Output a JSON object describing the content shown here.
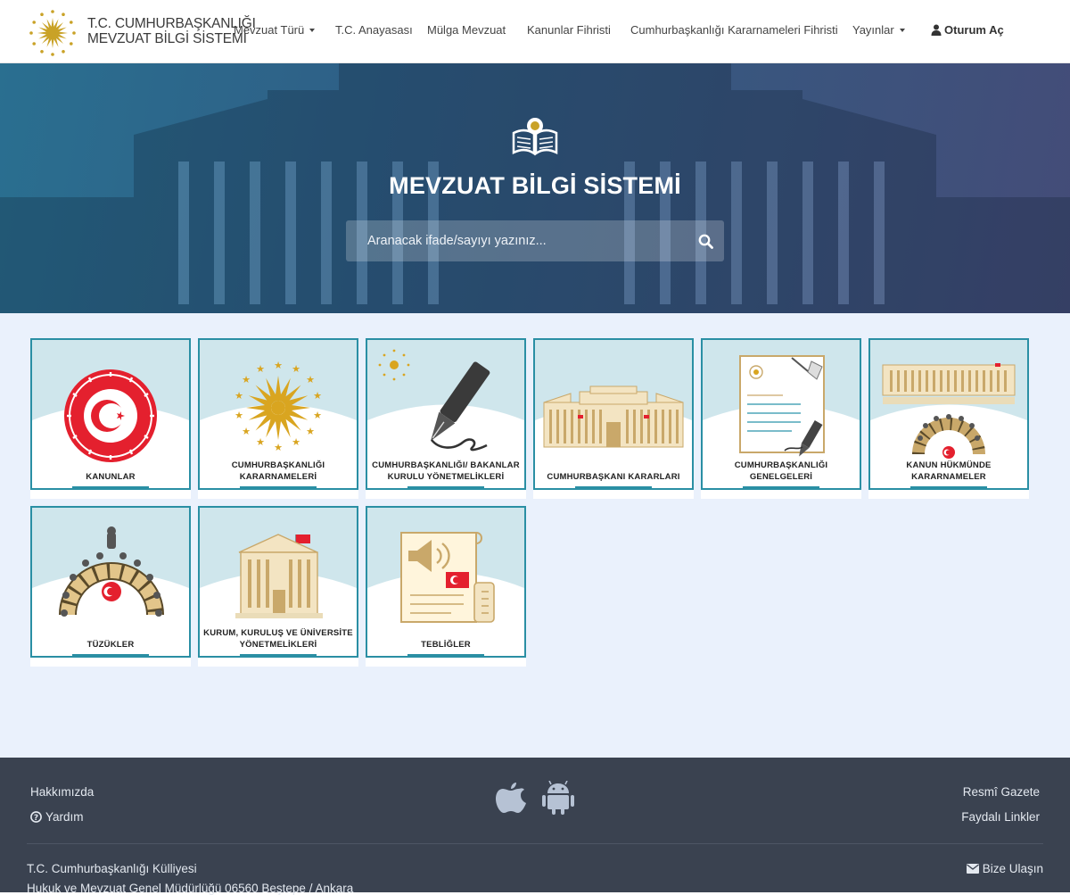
{
  "brand": {
    "line1": "T.C. CUMHURBAŞKANLIĞI",
    "line2": "MEVZUAT BİLGİ SİSTEMİ"
  },
  "nav": {
    "items": [
      {
        "label": "Mevzuat Türü",
        "dropdown": true
      },
      {
        "label": "T.C. Anayasası",
        "dropdown": false
      },
      {
        "label": "Mülga Mevzuat",
        "dropdown": false
      },
      {
        "label": "Kanunlar Fihristi",
        "dropdown": false
      },
      {
        "label": "Cumhurbaşkanlığı Kararnameleri Fihristi",
        "dropdown": false
      },
      {
        "label": "Yayınlar",
        "dropdown": true
      }
    ],
    "login_label": "Oturum Aç",
    "login_icon": "user-icon"
  },
  "hero": {
    "title": "MEVZUAT BİLGİ SİSTEMİ",
    "search_placeholder": "Aranacak ifade/sayıyı yazınız...",
    "search_icon": "search-icon"
  },
  "cards": [
    {
      "label": "KANUNLAR",
      "icon": "tbmm-seal-icon"
    },
    {
      "label": "CUMHURBAŞKANLIĞI KARARNAMELERİ",
      "icon": "presidential-emblem-icon"
    },
    {
      "label": "CUMHURBAŞKANLIĞI/ BAKANLAR KURULU YÖNETMELİKLERİ",
      "icon": "fountain-pen-icon"
    },
    {
      "label": "CUMHURBAŞKANI KARARLARI",
      "icon": "presidential-complex-icon"
    },
    {
      "label": "CUMHURBAŞKANLIĞI GENELGELERİ",
      "icon": "document-pen-icon"
    },
    {
      "label": "KANUN HÜKMÜNDE KARARNAMELER",
      "icon": "parliament-building-icon"
    },
    {
      "label": "TÜZÜKLER",
      "icon": "assembly-hall-icon"
    },
    {
      "label": "KURUM, KURULUŞ VE ÜNİVERSİTE YÖNETMELİKLERİ",
      "icon": "institution-building-icon"
    },
    {
      "label": "TEBLİĞLER",
      "icon": "announcement-document-icon"
    }
  ],
  "footer": {
    "about": "Hakkımızda",
    "help": "Yardım",
    "official_gazette": "Resmî Gazete",
    "useful_links": "Faydalı Linkler",
    "contact": "Bize Ulaşın",
    "address_line1": "T.C. Cumhurbaşkanlığı Külliyesi",
    "address_line2": "Hukuk ve Mevzuat Genel Müdürlüğü 06560 Beştepe / Ankara",
    "app_icons": [
      "apple-icon",
      "android-icon"
    ]
  },
  "colors": {
    "accent": "#2a8fa4",
    "hero_start": "#2a6f90",
    "hero_end": "#444c78",
    "main_bg": "#eaf1fc",
    "footer_bg": "#3a4250"
  }
}
